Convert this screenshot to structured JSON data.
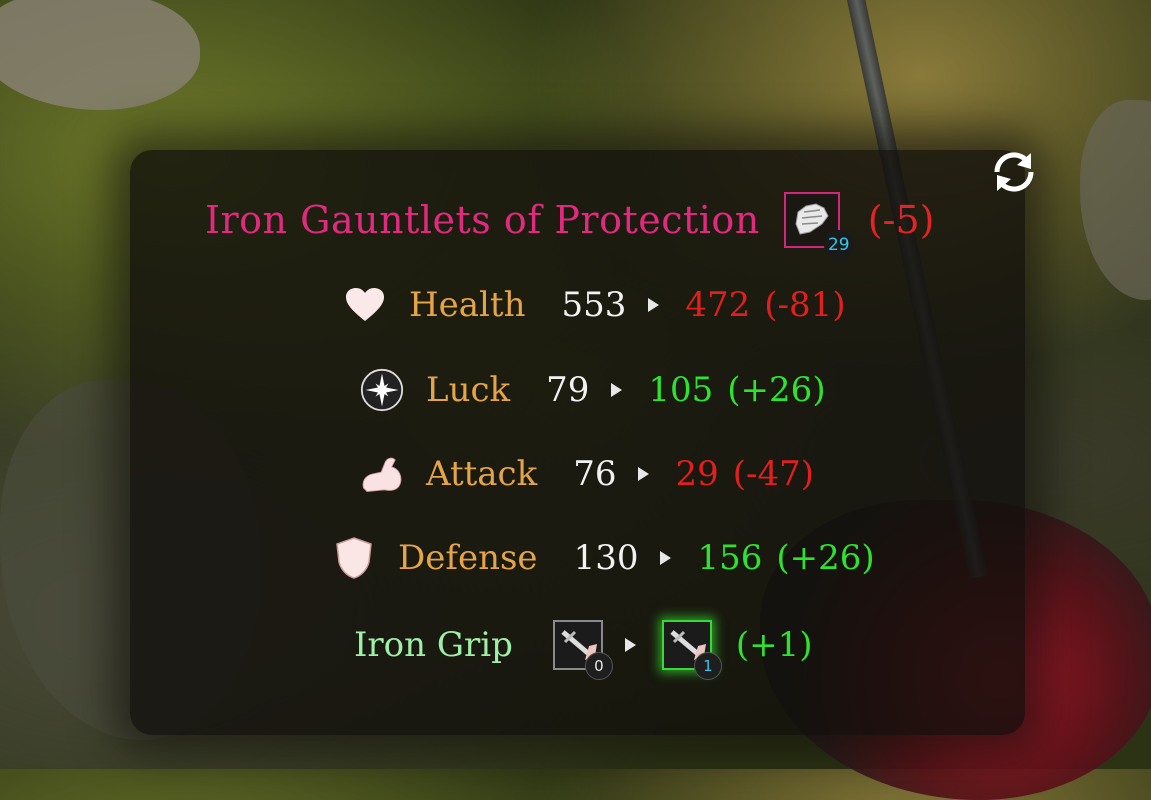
{
  "item": {
    "name": "Iron Gauntlets of Protection",
    "level": "29",
    "delta": "(-5)",
    "icon": "gauntlet-icon"
  },
  "stats": [
    {
      "icon": "heart-icon",
      "label": "Health",
      "old": "553",
      "new": "472",
      "delta": "(-81)",
      "trend": "negative"
    },
    {
      "icon": "star-compass-icon",
      "label": "Luck",
      "old": "79",
      "new": "105",
      "delta": "(+26)",
      "trend": "positive"
    },
    {
      "icon": "flexed-arm-icon",
      "label": "Attack",
      "old": "76",
      "new": "29",
      "delta": "(-47)",
      "trend": "negative"
    },
    {
      "icon": "shield-icon",
      "label": "Defense",
      "old": "130",
      "new": "156",
      "delta": "(+26)",
      "trend": "positive"
    }
  ],
  "skill": {
    "label": "Iron Grip",
    "old_level": "0",
    "new_level": "1",
    "delta": "(+1)",
    "icon": "sword-skill-icon"
  },
  "controls": {
    "swap_icon": "swap-arrows-icon"
  },
  "colors": {
    "title": "#e0297f",
    "negative": "#e21f1f",
    "positive": "#2ee32e",
    "stat_label": "#e5a448",
    "skill_label": "#9ef0a8",
    "level_badge": "#35c6ee"
  }
}
